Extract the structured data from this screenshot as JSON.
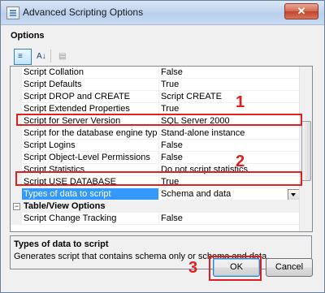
{
  "window": {
    "title": "Advanced Scripting Options",
    "close_glyph": "✕"
  },
  "options_label": "Options",
  "toolbar": {
    "categorized_icon": "categorized-icon",
    "alphabetical_icon": "alphabetical-icon",
    "property_pages_icon": "property-pages-icon"
  },
  "properties": [
    {
      "name": "Script Collation",
      "value": "False"
    },
    {
      "name": "Script Defaults",
      "value": "True"
    },
    {
      "name": "Script DROP and CREATE",
      "value": "Script CREATE"
    },
    {
      "name": "Script Extended Properties",
      "value": "True"
    },
    {
      "name": "Script for Server Version",
      "value": "SQL Server 2000"
    },
    {
      "name": "Script for the database engine type",
      "value": "Stand-alone instance"
    },
    {
      "name": "Script Logins",
      "value": "False"
    },
    {
      "name": "Script Object-Level Permissions",
      "value": "False"
    },
    {
      "name": "Script Statistics",
      "value": "Do not script statistics"
    },
    {
      "name": "Script USE DATABASE",
      "value": "True"
    },
    {
      "name": "Types of data to script",
      "value": "Schema and data"
    }
  ],
  "category": {
    "label": "Table/View Options",
    "toggle": "−"
  },
  "after_category": [
    {
      "name": "Script Change Tracking",
      "value": "False"
    }
  ],
  "description": {
    "title": "Types of data to script",
    "text": "Generates script that contains schema only or schema and data."
  },
  "buttons": {
    "ok": "OK",
    "cancel": "Cancel"
  },
  "annotations": {
    "one": "1",
    "two": "2",
    "three": "3"
  },
  "colors": {
    "annotation": "#e02020",
    "selection": "#3399ff"
  }
}
